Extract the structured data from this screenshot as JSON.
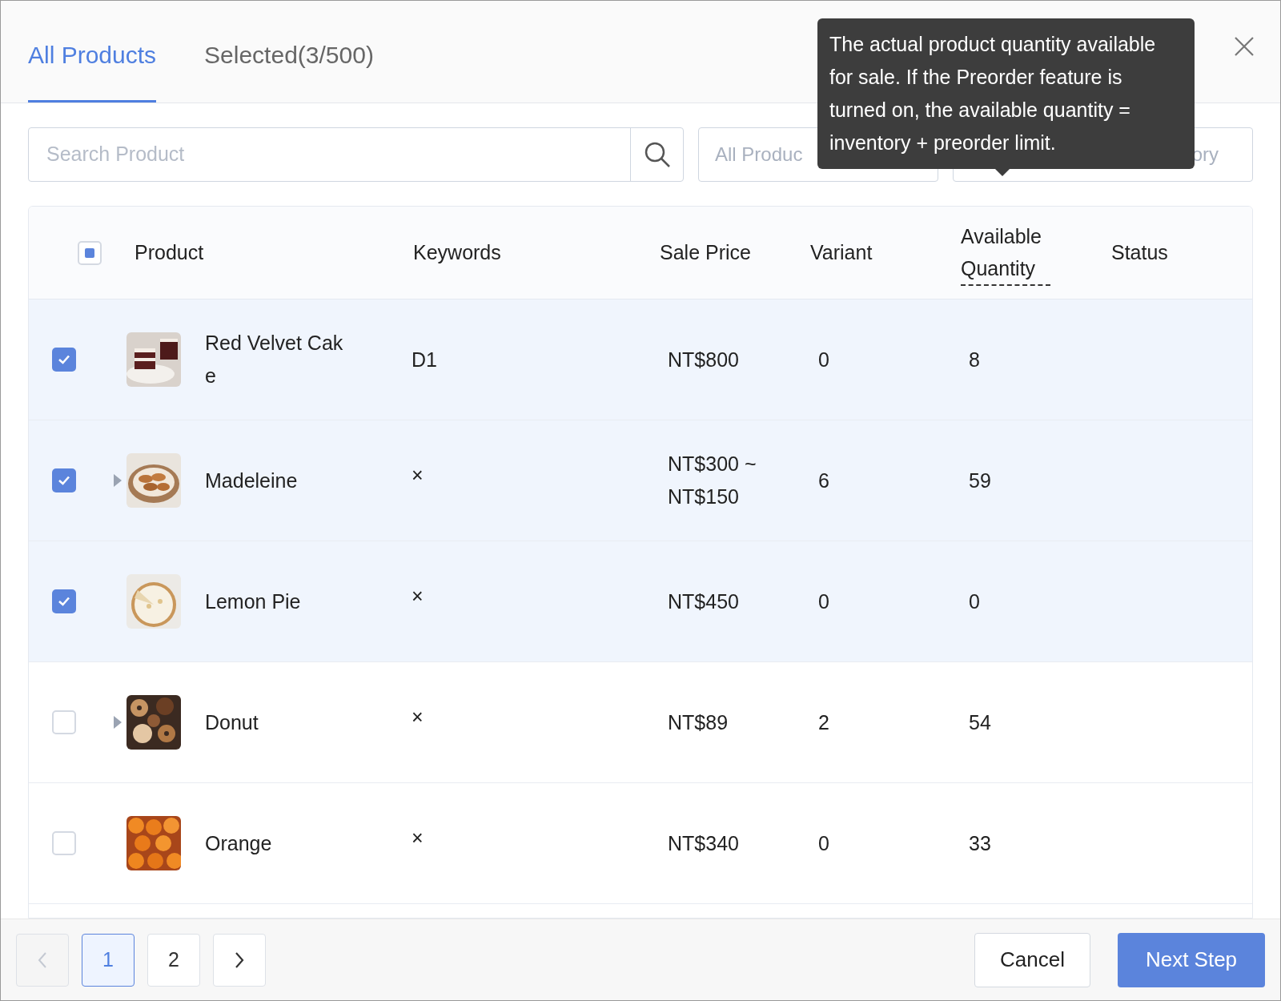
{
  "tabs": [
    {
      "label": "All Products",
      "selected": true
    },
    {
      "label": "Selected(3/500)",
      "selected": false
    }
  ],
  "search": {
    "placeholder": "Search Product"
  },
  "filters": [
    {
      "placeholder": "All Produc"
    },
    {
      "placeholder": "ory"
    }
  ],
  "tooltip": "The actual product quantity available for sale. If the Preorder feature is turned on, the available quantity = inventory + preorder limit.",
  "table": {
    "select_all_indeterminate": true,
    "columns": [
      "Product",
      "Keywords",
      "Sale Price",
      "Variant",
      "Available Quantity",
      "Status"
    ],
    "rows": [
      {
        "checked": true,
        "expandable": false,
        "product": "Red Velvet Cak\ne",
        "keywords": "D1",
        "price": "NT$800",
        "variant": "0",
        "available": "8"
      },
      {
        "checked": true,
        "expandable": true,
        "product": "Madeleine",
        "keywords": "×",
        "price": "NT$300 ~\nNT$150",
        "variant": "6",
        "available": "59"
      },
      {
        "checked": true,
        "expandable": false,
        "product": "Lemon Pie",
        "keywords": "×",
        "price": "NT$450",
        "variant": "0",
        "available": "0"
      },
      {
        "checked": false,
        "expandable": true,
        "product": "Donut",
        "keywords": "×",
        "price": "NT$89",
        "variant": "2",
        "available": "54"
      },
      {
        "checked": false,
        "expandable": false,
        "product": "Orange",
        "keywords": "×",
        "price": "NT$340",
        "variant": "0",
        "available": "33"
      }
    ]
  },
  "pagination": {
    "prev_disabled": true,
    "pages": [
      {
        "label": "1",
        "selected": true
      },
      {
        "label": "2",
        "selected": false
      }
    ]
  },
  "buttons": [
    {
      "label": "Cancel",
      "kind": "secondary"
    },
    {
      "label": "Next Step",
      "kind": "primary"
    }
  ]
}
